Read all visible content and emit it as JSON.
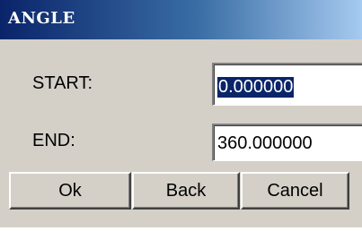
{
  "window": {
    "title": "ANGLE"
  },
  "form": {
    "start": {
      "label": "START:",
      "value": "0.000000",
      "selected": true
    },
    "end": {
      "label": "END:",
      "value": "360.000000"
    }
  },
  "buttons": {
    "ok_label": "Ok",
    "back_label": "Back",
    "cancel_label": "Cancel"
  },
  "colors": {
    "titlebar_start": "#0a246a",
    "titlebar_end": "#a6caf0",
    "dialog_face": "#d4d0c8",
    "selection": "#0a246a"
  }
}
